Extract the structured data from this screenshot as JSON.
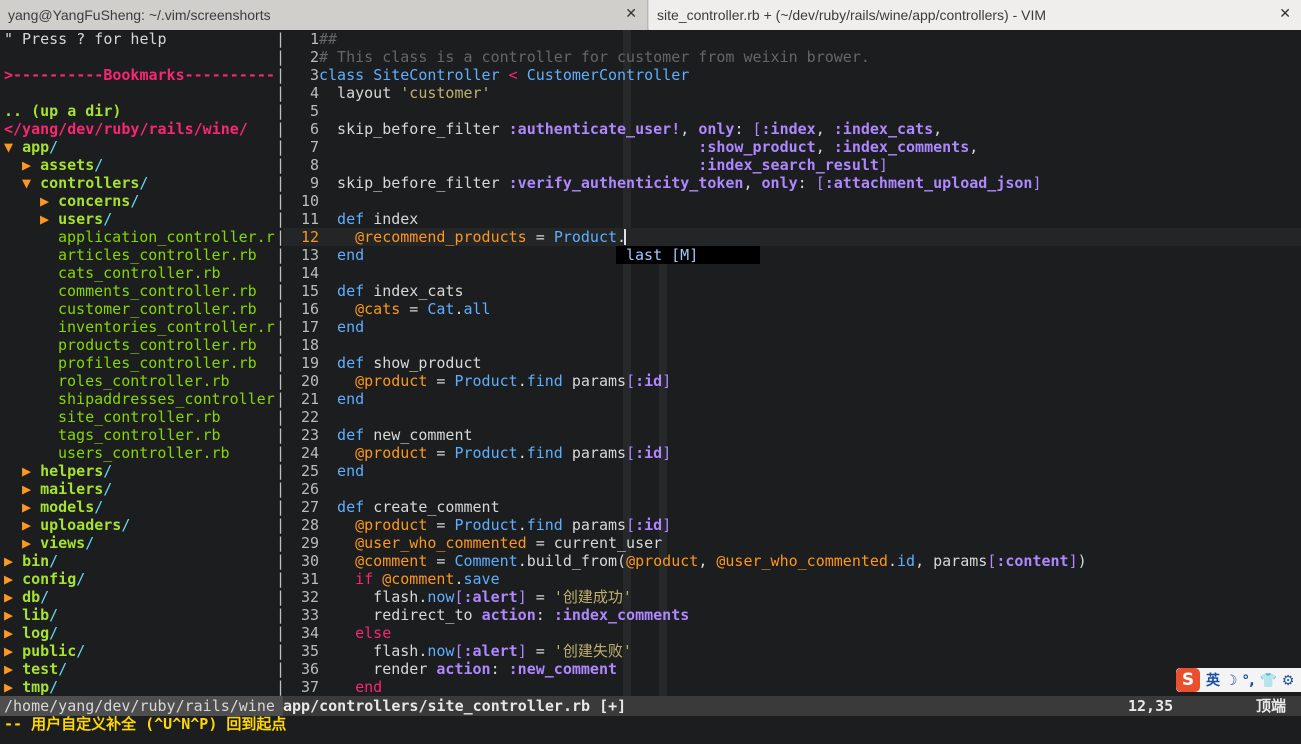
{
  "tabs": [
    {
      "title": "yang@YangFuSheng: ~/.vim/screenshorts",
      "close": "✕"
    },
    {
      "title": "site_controller.rb + (~/dev/ruby/rails/wine/app/controllers) - VIM",
      "close": "✕"
    }
  ],
  "tree": {
    "help": "\" Press ? for help",
    "bookmarks": ">----------Bookmarks----------",
    "updir": ".. (up a dir)",
    "root": "</yang/dev/ruby/rails/wine/",
    "items": [
      {
        "indent": 0,
        "arrow": "▼",
        "name": "app",
        "kind": "dir"
      },
      {
        "indent": 1,
        "arrow": "▶",
        "name": "assets",
        "kind": "dir"
      },
      {
        "indent": 1,
        "arrow": "▼",
        "name": "controllers",
        "kind": "dir"
      },
      {
        "indent": 2,
        "arrow": "▶",
        "name": "concerns",
        "kind": "dir"
      },
      {
        "indent": 2,
        "arrow": "▶",
        "name": "users",
        "kind": "dir"
      },
      {
        "indent": 3,
        "arrow": "",
        "name": "application_controller.r",
        "kind": "file"
      },
      {
        "indent": 3,
        "arrow": "",
        "name": "articles_controller.rb",
        "kind": "file"
      },
      {
        "indent": 3,
        "arrow": "",
        "name": "cats_controller.rb",
        "kind": "file"
      },
      {
        "indent": 3,
        "arrow": "",
        "name": "comments_controller.rb",
        "kind": "file"
      },
      {
        "indent": 3,
        "arrow": "",
        "name": "customer_controller.rb",
        "kind": "file"
      },
      {
        "indent": 3,
        "arrow": "",
        "name": "inventories_controller.r",
        "kind": "file"
      },
      {
        "indent": 3,
        "arrow": "",
        "name": "products_controller.rb",
        "kind": "file"
      },
      {
        "indent": 3,
        "arrow": "",
        "name": "profiles_controller.rb",
        "kind": "file"
      },
      {
        "indent": 3,
        "arrow": "",
        "name": "roles_controller.rb",
        "kind": "file"
      },
      {
        "indent": 3,
        "arrow": "",
        "name": "shipaddresses_controller",
        "kind": "file"
      },
      {
        "indent": 3,
        "arrow": "",
        "name": "site_controller.rb",
        "kind": "file"
      },
      {
        "indent": 3,
        "arrow": "",
        "name": "tags_controller.rb",
        "kind": "file"
      },
      {
        "indent": 3,
        "arrow": "",
        "name": "users_controller.rb",
        "kind": "file"
      },
      {
        "indent": 1,
        "arrow": "▶",
        "name": "helpers",
        "kind": "dir"
      },
      {
        "indent": 1,
        "arrow": "▶",
        "name": "mailers",
        "kind": "dir"
      },
      {
        "indent": 1,
        "arrow": "▶",
        "name": "models",
        "kind": "dir"
      },
      {
        "indent": 1,
        "arrow": "▶",
        "name": "uploaders",
        "kind": "dir"
      },
      {
        "indent": 1,
        "arrow": "▶",
        "name": "views",
        "kind": "dir"
      },
      {
        "indent": 0,
        "arrow": "▶",
        "name": "bin",
        "kind": "dir"
      },
      {
        "indent": 0,
        "arrow": "▶",
        "name": "config",
        "kind": "dir"
      },
      {
        "indent": 0,
        "arrow": "▶",
        "name": "db",
        "kind": "dir"
      },
      {
        "indent": 0,
        "arrow": "▶",
        "name": "lib",
        "kind": "dir"
      },
      {
        "indent": 0,
        "arrow": "▶",
        "name": "log",
        "kind": "dir"
      },
      {
        "indent": 0,
        "arrow": "▶",
        "name": "public",
        "kind": "dir"
      },
      {
        "indent": 0,
        "arrow": "▶",
        "name": "test",
        "kind": "dir"
      },
      {
        "indent": 0,
        "arrow": "▶",
        "name": "tmp",
        "kind": "dir"
      }
    ]
  },
  "editor": {
    "current_line": 12,
    "lines": [
      [
        [
          "cmt",
          "##"
        ]
      ],
      [
        [
          "cmt",
          "# This class is a controller for customer from weixin brower."
        ]
      ],
      [
        [
          "kw",
          "class "
        ],
        [
          "cls",
          "SiteController"
        ],
        [
          "pl",
          " "
        ],
        [
          "ctrl",
          "<"
        ],
        [
          "pl",
          " "
        ],
        [
          "cls",
          "CustomerController"
        ]
      ],
      [
        [
          "pl",
          "  layout "
        ],
        [
          "str",
          "'customer'"
        ]
      ],
      [
        [
          "pl",
          ""
        ]
      ],
      [
        [
          "pl",
          "  skip_before_filter "
        ],
        [
          "sym",
          ":authenticate_user!"
        ],
        [
          "pl",
          ", "
        ],
        [
          "sym",
          "only"
        ],
        [
          "pl",
          ": "
        ],
        [
          "brk",
          "["
        ],
        [
          "sym",
          ":index"
        ],
        [
          "pl",
          ", "
        ],
        [
          "sym",
          ":index_cats"
        ],
        [
          "pl",
          ","
        ]
      ],
      [
        [
          "pl",
          "                                          "
        ],
        [
          "sym",
          ":show_product"
        ],
        [
          "pl",
          ", "
        ],
        [
          "sym",
          ":index_comments"
        ],
        [
          "pl",
          ","
        ]
      ],
      [
        [
          "pl",
          "                                          "
        ],
        [
          "sym",
          ":index_search_result"
        ],
        [
          "brk",
          "]"
        ]
      ],
      [
        [
          "pl",
          "  skip_before_filter "
        ],
        [
          "sym",
          ":verify_authenticity_token"
        ],
        [
          "pl",
          ", "
        ],
        [
          "sym",
          "only"
        ],
        [
          "pl",
          ": "
        ],
        [
          "brk",
          "["
        ],
        [
          "sym",
          ":attachment_upload_json"
        ],
        [
          "brk",
          "]"
        ]
      ],
      [
        [
          "pl",
          ""
        ]
      ],
      [
        [
          "def",
          "  def "
        ],
        [
          "pl",
          "index"
        ]
      ],
      [
        [
          "pl",
          "    "
        ],
        [
          "ivar",
          "@recommend_products"
        ],
        [
          "pl",
          " = "
        ],
        [
          "cls",
          "Product"
        ],
        [
          "pl",
          "."
        ]
      ],
      [
        [
          "def",
          "  end"
        ]
      ],
      [
        [
          "pl",
          ""
        ]
      ],
      [
        [
          "def",
          "  def "
        ],
        [
          "pl",
          "index_cats"
        ]
      ],
      [
        [
          "pl",
          "    "
        ],
        [
          "ivar",
          "@cats"
        ],
        [
          "pl",
          " = "
        ],
        [
          "cls",
          "Cat"
        ],
        [
          "pl",
          "."
        ],
        [
          "kw",
          "all"
        ]
      ],
      [
        [
          "def",
          "  end"
        ]
      ],
      [
        [
          "pl",
          ""
        ]
      ],
      [
        [
          "def",
          "  def "
        ],
        [
          "pl",
          "show_product"
        ]
      ],
      [
        [
          "pl",
          "    "
        ],
        [
          "ivar",
          "@product"
        ],
        [
          "pl",
          " = "
        ],
        [
          "cls",
          "Product"
        ],
        [
          "pl",
          "."
        ],
        [
          "kw",
          "find"
        ],
        [
          "pl",
          " params"
        ],
        [
          "brk",
          "["
        ],
        [
          "sym",
          ":id"
        ],
        [
          "brk",
          "]"
        ]
      ],
      [
        [
          "def",
          "  end"
        ]
      ],
      [
        [
          "pl",
          ""
        ]
      ],
      [
        [
          "def",
          "  def "
        ],
        [
          "pl",
          "new_comment"
        ]
      ],
      [
        [
          "pl",
          "    "
        ],
        [
          "ivar",
          "@product"
        ],
        [
          "pl",
          " = "
        ],
        [
          "cls",
          "Product"
        ],
        [
          "pl",
          "."
        ],
        [
          "kw",
          "find"
        ],
        [
          "pl",
          " params"
        ],
        [
          "brk",
          "["
        ],
        [
          "sym",
          ":id"
        ],
        [
          "brk",
          "]"
        ]
      ],
      [
        [
          "def",
          "  end"
        ]
      ],
      [
        [
          "pl",
          ""
        ]
      ],
      [
        [
          "def",
          "  def "
        ],
        [
          "pl",
          "create_comment"
        ]
      ],
      [
        [
          "pl",
          "    "
        ],
        [
          "ivar",
          "@product"
        ],
        [
          "pl",
          " = "
        ],
        [
          "cls",
          "Product"
        ],
        [
          "pl",
          "."
        ],
        [
          "kw",
          "find"
        ],
        [
          "pl",
          " params"
        ],
        [
          "brk",
          "["
        ],
        [
          "sym",
          ":id"
        ],
        [
          "brk",
          "]"
        ]
      ],
      [
        [
          "pl",
          "    "
        ],
        [
          "ivar",
          "@user_who_commented"
        ],
        [
          "pl",
          " = current_user"
        ]
      ],
      [
        [
          "pl",
          "    "
        ],
        [
          "ivar",
          "@comment"
        ],
        [
          "pl",
          " = "
        ],
        [
          "cls",
          "Comment"
        ],
        [
          "pl",
          ".build_from("
        ],
        [
          "ivar",
          "@product"
        ],
        [
          "pl",
          ", "
        ],
        [
          "ivar",
          "@user_who_commented"
        ],
        [
          "pl",
          "."
        ],
        [
          "kw",
          "id"
        ],
        [
          "pl",
          ", params"
        ],
        [
          "brk",
          "["
        ],
        [
          "sym",
          ":content"
        ],
        [
          "brk",
          "]"
        ],
        [
          "pl",
          ")"
        ]
      ],
      [
        [
          "ctrl",
          "    if "
        ],
        [
          "ivar",
          "@comment"
        ],
        [
          "pl",
          "."
        ],
        [
          "kw",
          "save"
        ]
      ],
      [
        [
          "pl",
          "      flash."
        ],
        [
          "kw",
          "now"
        ],
        [
          "brk",
          "["
        ],
        [
          "sym",
          ":alert"
        ],
        [
          "brk",
          "]"
        ],
        [
          "pl",
          " = "
        ],
        [
          "str",
          "'创建成功'"
        ]
      ],
      [
        [
          "pl",
          "      redirect_to "
        ],
        [
          "sym",
          "action"
        ],
        [
          "pl",
          ": "
        ],
        [
          "sym",
          ":index_comments"
        ]
      ],
      [
        [
          "ctrl",
          "    else"
        ]
      ],
      [
        [
          "pl",
          "      flash."
        ],
        [
          "kw",
          "now"
        ],
        [
          "brk",
          "["
        ],
        [
          "sym",
          ":alert"
        ],
        [
          "brk",
          "]"
        ],
        [
          "pl",
          " = "
        ],
        [
          "str",
          "'创建失败'"
        ]
      ],
      [
        [
          "pl",
          "      render "
        ],
        [
          "sym",
          "action"
        ],
        [
          "pl",
          ": "
        ],
        [
          "sym",
          ":new_comment"
        ]
      ],
      [
        [
          "ctrl",
          "    end"
        ]
      ]
    ]
  },
  "completion": {
    "word": "last",
    "kind": "[M]"
  },
  "status": {
    "left_path": "/home/yang/dev/ruby/rails/wine",
    "file": "app/controllers/site_controller.rb [+]",
    "position": "12,35",
    "scroll": "顶端"
  },
  "cmdline": "-- 用户自定义补全 (^U^N^P) 回到起点",
  "ime": {
    "logo": "S",
    "label": "英 ☽ °, 👕 ⚙"
  },
  "colors": {
    "background": "#1b1d1e",
    "comment": "#666666",
    "keyword": "#5fafff",
    "symbol": "#af87ff",
    "ivar": "#fd971f",
    "dir": "#a6e22e",
    "bookmark": "#f92672"
  }
}
